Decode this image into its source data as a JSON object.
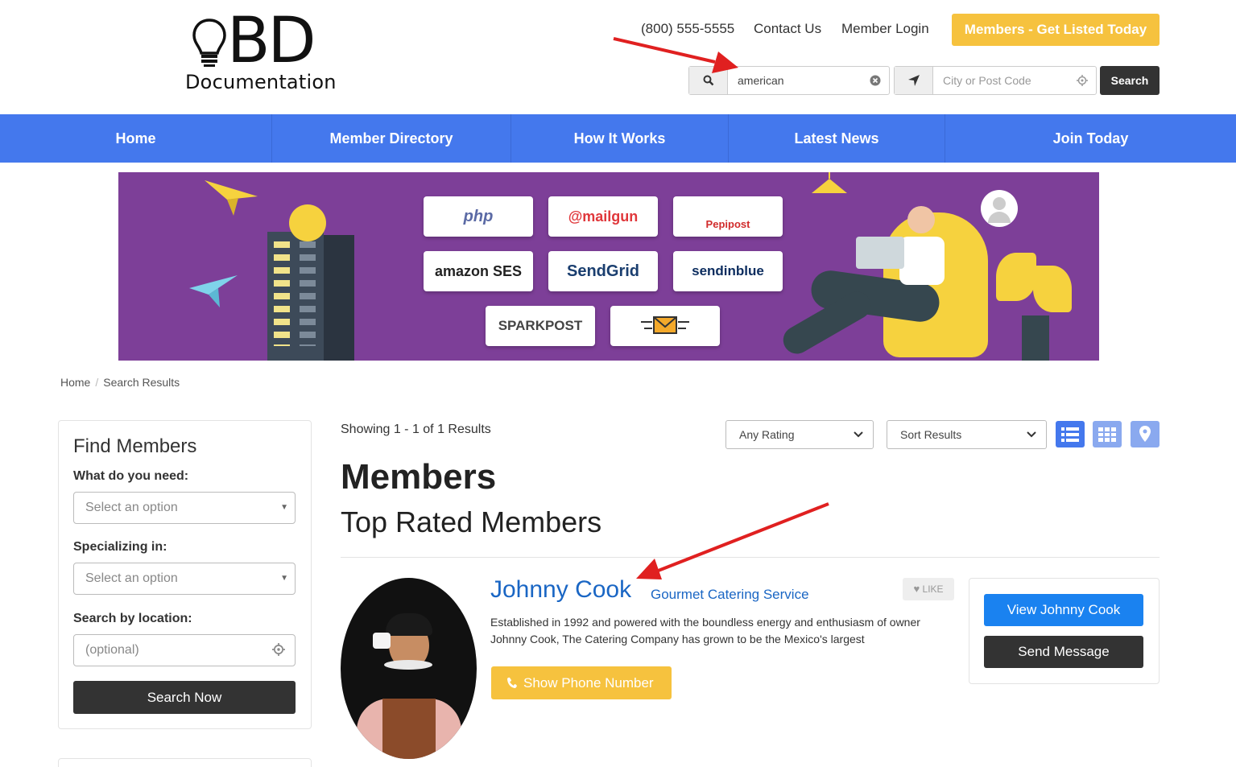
{
  "header": {
    "logo_big": "BD",
    "logo_sub": "Documentation",
    "phone": "(800) 555-5555",
    "contact": "Contact Us",
    "login": "Member Login",
    "cta": "Members - Get Listed Today",
    "search_value": "american",
    "location_placeholder": "City or Post Code",
    "search_button": "Search"
  },
  "nav": [
    "Home",
    "Member Directory",
    "How It Works",
    "Latest News",
    "Join Today"
  ],
  "banner": {
    "tiles": [
      "php",
      "@mailgun",
      "Pepipost",
      "amazon SES",
      "SendGrid",
      "sendinblue",
      "SPARKPOST",
      ""
    ]
  },
  "breadcrumb": {
    "home": "Home",
    "current": "Search Results"
  },
  "sidebar": {
    "title": "Find Members",
    "need_label": "What do you need:",
    "need_placeholder": "Select an option",
    "specializing_label": "Specializing in:",
    "specializing_placeholder": "Select an option",
    "location_label": "Search by location:",
    "location_placeholder": "(optional)",
    "search_button": "Search Now"
  },
  "results": {
    "showing": "Showing 1 - 1 of 1 Results",
    "rating_filter": "Any Rating",
    "sort": "Sort Results",
    "heading": "Members",
    "subheading": "Top Rated Members"
  },
  "member": {
    "name": "Johnny Cook",
    "category": "Gourmet Catering Service",
    "like": "LIKE",
    "description": "Established in 1992 and powered with the boundless energy and enthusiasm of owner Johnny Cook, The Catering Company has grown to be the Mexico's largest",
    "phone_button": "Show Phone Number",
    "view_button": "View Johnny Cook",
    "message_button": "Send Message"
  },
  "colors": {
    "nav": "#4478ed",
    "cta": "#f6c23e",
    "primary": "#1a82f0",
    "dark": "#333333",
    "banner": "#7d3f98",
    "annotation_arrow": "#e02020"
  }
}
